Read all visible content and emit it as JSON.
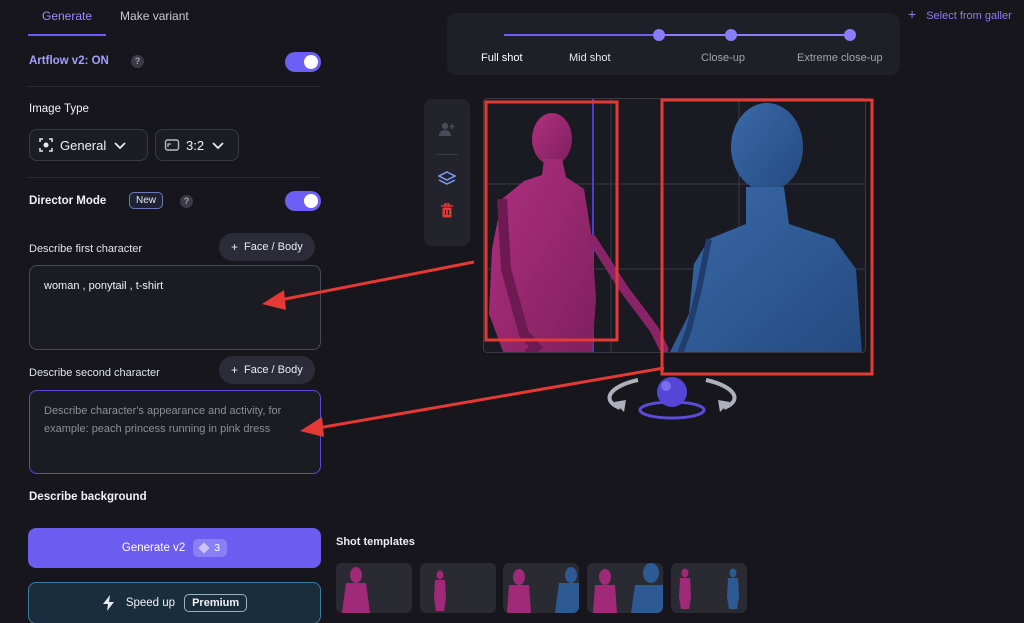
{
  "tabs": [
    {
      "label": "Generate",
      "active": true
    },
    {
      "label": "Make variant",
      "active": false
    }
  ],
  "artflow": {
    "label": "Artflow v2: ON",
    "help": "?",
    "enabled": true
  },
  "image_type": {
    "label": "Image Type",
    "type_value": "General",
    "ratio_value": "3:2"
  },
  "director": {
    "label": "Director Mode",
    "badge": "New",
    "help": "?",
    "enabled": true
  },
  "first_character": {
    "label": "Describe first character",
    "button": "Face / Body",
    "value": "woman , ponytail , t-shirt"
  },
  "second_character": {
    "label": "Describe second character",
    "button": "Face / Body",
    "placeholder": "Describe character's appearance and activity, for example: peach princess running in pink dress"
  },
  "background": {
    "label": "Describe background"
  },
  "generate": {
    "label": "Generate v2",
    "credits": "3"
  },
  "speed": {
    "label": "Speed up",
    "badge": "Premium"
  },
  "shots": {
    "labels": [
      "Full shot",
      "Mid shot",
      "Close-up",
      "Extreme close-up"
    ]
  },
  "gallery": {
    "label": "Select from galler"
  },
  "templates": {
    "label": "Shot templates",
    "count": 5
  },
  "colors": {
    "accent": "#6c5cf0",
    "character1": "#a02a78",
    "character2": "#2e5a93",
    "annotation": "#e53935"
  },
  "icons": [
    "camera-scan-icon",
    "aspect-ratio-icon",
    "chevron-down-icon",
    "add-person-icon",
    "layers-icon",
    "trash-icon",
    "lightning-icon",
    "gem-icon",
    "rotate-arrows-icon"
  ]
}
